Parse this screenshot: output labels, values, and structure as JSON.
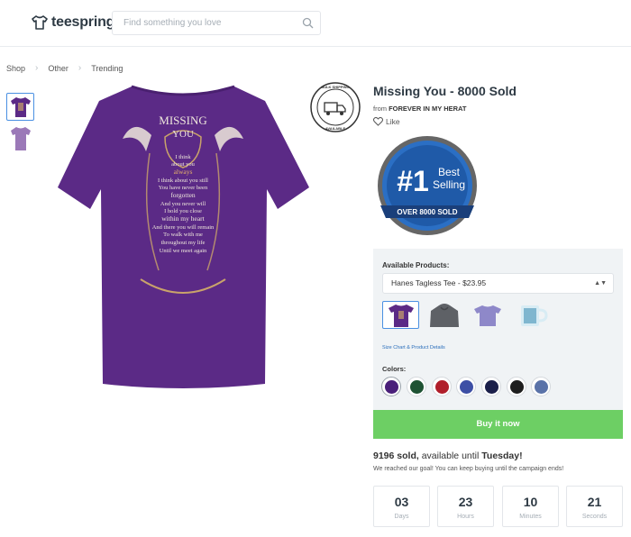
{
  "header": {
    "logo_text": "teespring",
    "search_placeholder": "Find something you love"
  },
  "breadcrumb": [
    "Shop",
    "Other",
    "Trending"
  ],
  "product": {
    "title": "Missing You - 8000 Sold",
    "from_prefix": "from",
    "seller": "FOREVER IN MY HERAT",
    "like_label": "Like",
    "shirt_color": "#5b2a86",
    "shipping_badge_text": "BULK SHIPPING AVAILABLE",
    "best_badge": {
      "hash_one": "#1",
      "line1": "Best",
      "line2": "Selling",
      "banner": "OVER 8000 SOLD"
    },
    "print_text": {
      "title1": "MISSING",
      "title2": "YOU",
      "poem": [
        "I think",
        "about you",
        "always",
        "I think about you still",
        "You have never been",
        "forgotten",
        "And you never will",
        "I hold you close",
        "within my heart",
        "And there you will remain",
        "To walk with me",
        "throughout my life",
        "Until we meet again"
      ]
    }
  },
  "panel": {
    "available_label": "Available Products:",
    "selected_product": "Hanes Tagless Tee - $23.95",
    "size_link": "Size Chart & Product Details",
    "colors_label": "Colors:",
    "colors": [
      "#4a1f7a",
      "#1e5233",
      "#b01e2a",
      "#3d4fa5",
      "#1b1f4a",
      "#1e1e1e",
      "#5a72a8"
    ],
    "buy_label": "Buy it now"
  },
  "sales": {
    "sold_count": "9196 sold,",
    "available_text": "available until",
    "until_day": "Tuesday!",
    "goal_text": "We reached our goal! You can keep buying until the campaign ends!"
  },
  "countdown": [
    {
      "value": "03",
      "label": "Days"
    },
    {
      "value": "23",
      "label": "Hours"
    },
    {
      "value": "10",
      "label": "Minutes"
    },
    {
      "value": "21",
      "label": "Seconds"
    }
  ]
}
